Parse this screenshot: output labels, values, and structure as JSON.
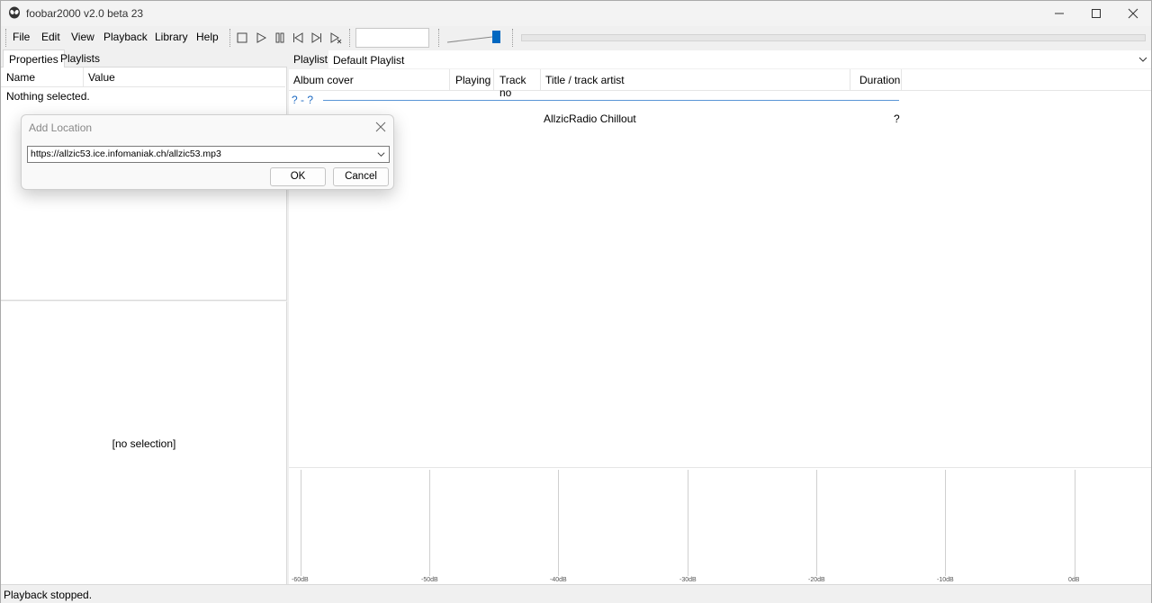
{
  "window": {
    "title": "foobar2000 v2.0 beta 23"
  },
  "menu": [
    "File",
    "Edit",
    "View",
    "Playback",
    "Library",
    "Help"
  ],
  "toolbar": {
    "buttons": [
      "stop-icon",
      "play-icon",
      "pause-icon",
      "previous-icon",
      "next-icon",
      "random-icon"
    ]
  },
  "left_panel": {
    "tabs": [
      "Properties",
      "Playlists"
    ],
    "columns": [
      "Name",
      "Value"
    ],
    "empty_text": "Nothing selected.",
    "bottom_text": "[no selection]"
  },
  "playlist": {
    "label": "Playlist:",
    "selected": "Default Playlist",
    "columns": [
      "Album cover",
      "Playing",
      "Track no",
      "Title / track artist",
      "Duration"
    ],
    "group_header": "? - ?",
    "tracks": [
      {
        "title": "AllzicRadio Chillout",
        "duration": "?"
      }
    ]
  },
  "meter": {
    "labels": [
      "-60dB",
      "-50dB",
      "-40dB",
      "-30dB",
      "-20dB",
      "-10dB",
      "0dB"
    ]
  },
  "status": {
    "text": "Playback stopped."
  },
  "dialog": {
    "title": "Add Location",
    "url": "https://allzic53.ice.infomaniak.ch/allzic53.mp3",
    "ok": "OK",
    "cancel": "Cancel"
  },
  "colors": {
    "accent": "#0067c0",
    "group_text": "#1e6ac2"
  }
}
